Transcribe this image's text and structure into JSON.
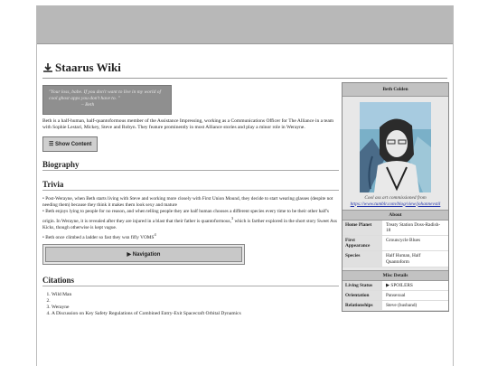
{
  "wiki": {
    "title": "Staarus Wiki"
  },
  "quote": {
    "text": "\"Your loss, babe. If you don't want to live in my world of cool ghost apps you don't have to. \"",
    "attribution": "Beth"
  },
  "intro": "Beth is a half-human, half-quantoformous member of the Assistance Impressing, working as a Communications Officer for The Alliance in a team with Sophie Lestari, Mickey, Steve and Robyn. They feature prominently in most Alliance stories and play a minor role in Werayne.",
  "toc_button": "Show Content",
  "sections": {
    "biography": "Biography",
    "trivia": "Trivia",
    "citations": "Citations"
  },
  "trivia": [
    "Post-Werayne, when Beth starts living with Steve and working more closely with First Union Mound, they decide to start wearing glasses (despite not needing them) because they think it makes them look sexy and mature",
    "Beth enjoys lying to people for no reason, and when telling people they are half human chooses a different species every time to be their other half's origin. In Werayne, it is revealed after they are injured in a blast that their father is quantoformous,",
    "Beth once climbed a ladder so fast they wsn fifly VOMS"
  ],
  "trivia_sup": {
    "s2": "3",
    "s3": "4"
  },
  "trivia_tail": "which is farther explored in the short story Sweet Ass Kicks, though otherwise is kept vague.",
  "navigation": {
    "label": "Navigation"
  },
  "citations": [
    "Wild Man",
    "",
    "Werayne",
    "A Discussion on Key Safety Regulations of Combined Entry-Exit Spacecraft Orbital Dynamics"
  ],
  "infobox": {
    "title": "Beth Colden",
    "caption": "Cool ass art commissioned from",
    "caption_link": "https://www.tumblr.com/blog/view/johannevstil",
    "about": "About",
    "rows": [
      {
        "label": "Home Planet",
        "value": "Treaty Station Doss-Radish-18"
      },
      {
        "label": "First Appearance",
        "value": "Grouncycle Blues"
      },
      {
        "label": "Species",
        "value": "Half Human, Half Quantoform"
      }
    ],
    "misc": "Misc Details",
    "misc_rows": [
      {
        "label": "Living Status",
        "value": "SPOILERS"
      },
      {
        "label": "Orientation",
        "value": "Pansexual"
      },
      {
        "label": "Relationships",
        "value": "Steve (husband)"
      }
    ]
  },
  "colors": {
    "band": "#b8b8b8",
    "quote_bg": "#8f8f8f",
    "section_header": "#c2c2c2"
  }
}
